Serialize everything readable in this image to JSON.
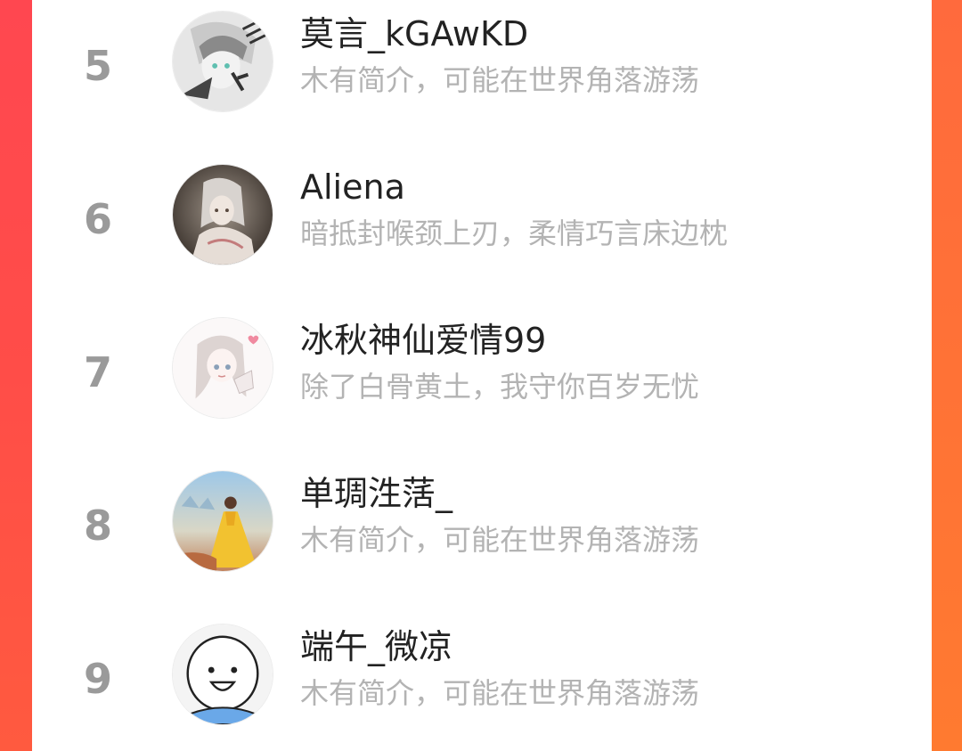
{
  "ranking": {
    "items": [
      {
        "rank": "5",
        "name": "莫言_kGAwKD",
        "bio": "木有简介，可能在世界角落游荡",
        "avatar_icon": "anime-boy-avatar-icon"
      },
      {
        "rank": "6",
        "name": "Aliena",
        "bio": "暗抵封喉颈上刃，柔情巧言床边枕",
        "avatar_icon": "anime-girl-dark-avatar-icon"
      },
      {
        "rank": "7",
        "name": "冰秋神仙爱情99",
        "bio": "除了白骨黄土，我守你百岁无忧",
        "avatar_icon": "anime-girl-sketch-avatar-icon"
      },
      {
        "rank": "8",
        "name": "单琱泩萿_",
        "bio": "木有简介，可能在世界角落游荡",
        "avatar_icon": "yellow-dress-avatar-icon"
      },
      {
        "rank": "9",
        "name": "端午_微凉",
        "bio": "木有简介，可能在世界角落游荡",
        "avatar_icon": "smiley-face-avatar-icon"
      }
    ]
  },
  "colors": {
    "background_left": "#ff4750",
    "background_right": "#ff7236",
    "panel": "#ffffff",
    "rank_text": "#9a9a9a",
    "name_text": "#222222",
    "bio_text": "#b3b3b3"
  }
}
